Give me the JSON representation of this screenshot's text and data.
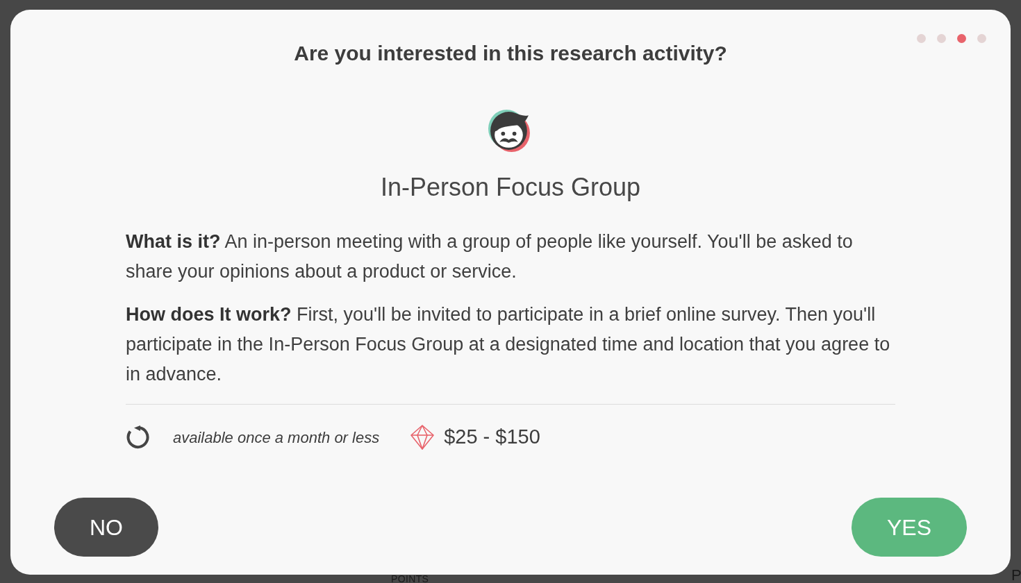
{
  "background": {
    "texts": [
      "POINTS",
      "P"
    ]
  },
  "dialog": {
    "title": "Are you interested in this research activity?",
    "steps": [
      {
        "selected": false
      },
      {
        "selected": false
      },
      {
        "selected": true
      },
      {
        "selected": false
      }
    ],
    "activity": "In-Person Focus Group",
    "description": [
      "**What is it?** An in-person meeting with a group of people like yourself. You'll be asked to share your opinions about a product or service.",
      "**How does It work?** First, you'll be invited to participate in a brief online survey. Then you'll participate in the In-Person Focus Group at a designated time and location that you agree to in advance."
    ],
    "frequency": "available once a month or less",
    "reward": "$25 - $150",
    "buttons": [
      {
        "kind": "decline",
        "label": "NO"
      },
      {
        "kind": "accept",
        "label": "YES"
      }
    ]
  }
}
